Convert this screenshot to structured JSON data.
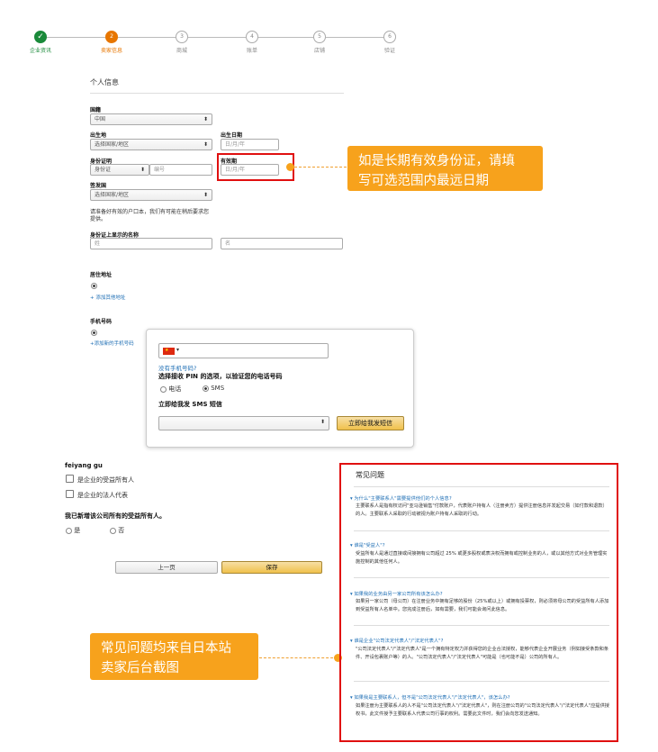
{
  "steps": [
    {
      "num": "✓",
      "label": "企业资讯",
      "state": "done"
    },
    {
      "num": "2",
      "label": "卖家信息",
      "state": "active"
    },
    {
      "num": "3",
      "label": "商城",
      "state": "pending"
    },
    {
      "num": "4",
      "label": "账单",
      "state": "pending"
    },
    {
      "num": "5",
      "label": "店铺",
      "state": "pending"
    },
    {
      "num": "6",
      "label": "验证",
      "state": "pending"
    }
  ],
  "personal": {
    "section_title": "个人信息",
    "country_label": "国籍",
    "country_value": "中国",
    "birthplace_label": "出生地",
    "birthplace_value": "选择国家/地区",
    "birthdate_label": "出生日期",
    "birthdate_placeholder": "日/月/年",
    "id_label": "身份证明",
    "id_type_value": "身份证",
    "id_number_placeholder": "编号",
    "expiry_label": "有效期",
    "expiry_placeholder": "日/月/年",
    "issuer_label": "签发国",
    "issuer_value": "选择国家/地区",
    "hukou_note_1": "请准备好有效的户口本，我们有可能在稍后要求您",
    "hukou_note_2": "提供。",
    "name_label": "身份证上显示的名称",
    "last_name_placeholder": "姓",
    "first_name_placeholder": "名",
    "address_label": "居住地址",
    "add_address_link": "+ 添加其他地址",
    "phone_label": "手机号码",
    "add_phone_link": "+添加新的手机号码"
  },
  "popup": {
    "flag_arrow": "▾",
    "no_phone_link": "没有手机号码?",
    "choose_pin_label": "选择接收 PIN 的选项，以验证您的电话号码",
    "option_call": "电话",
    "option_sms": "SMS",
    "send_now_label": "立即给我发 SMS 短信",
    "send_button": "立即给我发短信"
  },
  "beneficiary": {
    "user_name": "feiyang gu",
    "chk_owner": "是企业的受益所有人",
    "chk_legal": "是企业的法人代表",
    "question": "我已新增该公司所有的受益所有人。",
    "opt_yes": "是",
    "opt_no": "否"
  },
  "buttons": {
    "prev": "上一页",
    "save": "保存"
  },
  "callouts": {
    "expiry_line1": "如是长期有效身份证，请填",
    "expiry_line2": "写可选范围内最远日期",
    "faq_line1": "常见问题均来自日本站",
    "faq_line2": "卖家后台截图"
  },
  "faq": {
    "title": "常见问题",
    "items": [
      {
        "q": "▾ 为什么\"主要联系人\"需要提供他们的个人信息?",
        "a": "主要联系人是指有权访问\"亚马逊销售\"付款账户，代表账户持有人（注册卖方）提供注册信息并发起交易（如付款和退款）的人。主要联系人采取的行动被视为账户持有人采取的行动。"
      },
      {
        "q": "▾ 谁是\"受益人\"?",
        "a": "受益所有人是通过直接或间接拥有公司超过 25% 或更多股权或表决权而拥有或控制业务的人，或以其他方式对业务管理实施控制的其他任何人。"
      },
      {
        "q": "▾ 如果我的业务由另一家公司所有该怎么办?",
        "a": "如果另一家公司（母公司）在注册业务中拥有足够的股份（25%或以上）或拥有投票权，则必须将母公司的受益所有人添加到受益所有人名单中。您完成注册后，如有需要，我们可能会询问此信息。"
      },
      {
        "q": "▾ 谁是企业\"公司法定代表人\"/\"法定代表人\"?",
        "a": "\"公司法定代表人\"/\"法定代表人\"是一个拥有特定权力并获得您的企业合法授权，能够代表企业开展业务（例如接受条款和条件、开设包裹账户等）的人。\"公司法定代表人\"/\"法定代表人\"可能是（也可能不是）公司的所有人。"
      },
      {
        "q": "▾ 如果我是主要联系人，但不是\"公司法定代表人\"/\"法定代表人\"，该怎么办?",
        "a": "如果注册为主要联系人的人不是\"公司法定代表人\"/\"法定代表人\"，则在注册公司的\"公司法定代表人\"/\"法定代表人\"应提供授权书，此文件授予主要联系人代表公司行事的权利。需要此文件时，我们会向您发送通知。"
      }
    ]
  }
}
